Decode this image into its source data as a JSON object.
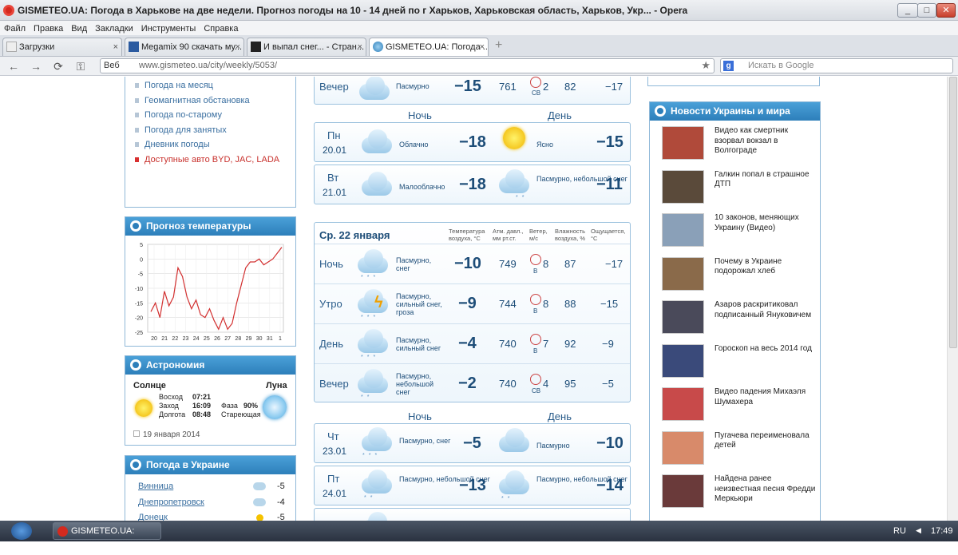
{
  "window": {
    "title": "GISMETEO.UA: Погода в Харькове на две недели. Прогноз погоды на 10 - 14 дней по г Харьков, Харьковская область, Харьков, Укр... - Opera",
    "min": "_",
    "max": "□",
    "close": "✕"
  },
  "menu": [
    "Файл",
    "Правка",
    "Вид",
    "Закладки",
    "Инструменты",
    "Справка"
  ],
  "tabs": [
    {
      "label": "Загрузки",
      "x": 3
    },
    {
      "label": "Megamix 90 скачать му...",
      "x": 156
    },
    {
      "label": "И выпал снег... - Стран...",
      "x": 309
    },
    {
      "label": "GISMETEO.UA: Погода ...",
      "x": 462
    }
  ],
  "tab_close": "×",
  "new_tab": "+",
  "nav": {
    "back": "←",
    "forward": "→",
    "reload": "⟳",
    "key": "⚿",
    "web": "Веб",
    "url": "www.gismeteo.ua/city/weekly/5053/",
    "star": "★"
  },
  "search": {
    "engine": "g",
    "placeholder": "Искать в Google"
  },
  "left_links": [
    {
      "label": "Погода на месяц",
      "red": false
    },
    {
      "label": "Геомагнитная обстановка",
      "red": false
    },
    {
      "label": "Погода по-старому",
      "red": false
    },
    {
      "label": "Погода для занятых",
      "red": false
    },
    {
      "label": "Дневник погоды",
      "red": false
    },
    {
      "label": "Доступные авто BYD, JAC, LADA",
      "red": true
    }
  ],
  "temp_forecast": {
    "title": "Прогноз температуры",
    "y_ticks": [
      "5",
      "0",
      "-5",
      "-10",
      "-15",
      "-20",
      "-25"
    ],
    "x_ticks": [
      "20",
      "21",
      "22",
      "23",
      "24",
      "25",
      "26",
      "27",
      "28",
      "29",
      "30",
      "31",
      "1"
    ],
    "chart_data": {
      "type": "line",
      "x": [
        "20",
        "21",
        "22",
        "23",
        "24",
        "25",
        "26",
        "27",
        "28",
        "29",
        "30",
        "31",
        "1"
      ],
      "ylim": [
        -25,
        5
      ],
      "series": [
        {
          "values": [
            -18,
            -15,
            -20,
            -11,
            -16,
            -13,
            -3,
            -6,
            -13,
            -17,
            -14,
            -19,
            -20,
            -17,
            -21,
            -24,
            -20,
            -24,
            -22,
            -15,
            -9,
            -3,
            -1,
            -1,
            0,
            -2,
            -1,
            0,
            2,
            4
          ]
        }
      ]
    }
  },
  "astronomy": {
    "title": "Астрономия",
    "sun": "Солнце",
    "moon": "Луна",
    "sunrise_label": "Восход",
    "sunrise": "07:21",
    "sunset_label": "Заход",
    "sunset": "16:09",
    "day_label": "Долгота",
    "day": "08:48",
    "phase_label": "Фаза",
    "phase": "90%",
    "phase_name": "Стареющая",
    "date": "19 января 2014"
  },
  "ukraine": {
    "title": "Погода в Украине",
    "cities": [
      {
        "name": "Винница",
        "temp": "-5"
      },
      {
        "name": "Днепропетровск",
        "temp": "-4"
      },
      {
        "name": "Донецк",
        "temp": "-5"
      }
    ]
  },
  "top_row": {
    "label": "Вечер",
    "desc": "Пасмурно",
    "temp": "−15",
    "pressure": "761",
    "wind": "2",
    "dir": "СВ",
    "hum": "82",
    "feels": "−17"
  },
  "col_night": "Ночь",
  "col_day": "День",
  "days_a": [
    {
      "dow": "Пн",
      "date": "20.01",
      "night_desc": "Облачно",
      "night_temp": "−18",
      "day_desc": "Ясно",
      "day_temp": "−15"
    },
    {
      "dow": "Вт",
      "date": "21.01",
      "night_desc": "Малооблачно",
      "night_temp": "−18",
      "day_desc": "Пасмурно, небольшой снег",
      "day_temp": "−11"
    }
  ],
  "detail": {
    "title": "Ср. 22 января",
    "h_temp": "Температура воздуха, °C",
    "h_press": "Атм. давл., мм рт.ст.",
    "h_wind": "Ветер, м/с",
    "h_hum": "Влажность воздуха, %",
    "h_feels": "Ощущается, °C",
    "rows": [
      {
        "label": "Ночь",
        "desc": "Пасмурно, снег",
        "temp": "−10",
        "press": "749",
        "wind": "8",
        "dir": "В",
        "hum": "87",
        "feels": "−17"
      },
      {
        "label": "Утро",
        "desc": "Пасмурно, сильный снег, гроза",
        "temp": "−9",
        "press": "744",
        "wind": "8",
        "dir": "В",
        "hum": "88",
        "feels": "−15"
      },
      {
        "label": "День",
        "desc": "Пасмурно, сильный снег",
        "temp": "−4",
        "press": "740",
        "wind": "7",
        "dir": "В",
        "hum": "92",
        "feels": "−9"
      },
      {
        "label": "Вечер",
        "desc": "Пасмурно, небольшой снег",
        "temp": "−2",
        "press": "740",
        "wind": "4",
        "dir": "СВ",
        "hum": "95",
        "feels": "−5"
      }
    ]
  },
  "days_b": [
    {
      "dow": "Чт",
      "date": "23.01",
      "night_desc": "Пасмурно, снег",
      "night_temp": "−5",
      "day_desc": "Пасмурно",
      "day_temp": "−10"
    },
    {
      "dow": "Пт",
      "date": "24.01",
      "night_desc": "Пасмурно, небольшой снег",
      "night_temp": "−13",
      "day_desc": "Пасмурно, небольшой снег",
      "day_temp": "−14"
    }
  ],
  "news": {
    "title": "Новости Украины и мира",
    "items": [
      {
        "text": "Видео как смертник взорвал вокзал в Волгограде",
        "color": "#b04a3a"
      },
      {
        "text": "Галкин попал в страшное ДТП",
        "color": "#5a4a3a"
      },
      {
        "text": "10 законов, меняющих Украину (Видео)",
        "color": "#8aa0b8"
      },
      {
        "text": "Почему в Украине подорожал хлеб",
        "color": "#8a6a4a"
      },
      {
        "text": "Азаров раскритиковал подписанный Януковичем",
        "color": "#4a4a5a"
      },
      {
        "text": "Гороскоп на весь 2014 год",
        "color": "#3a4a7a"
      },
      {
        "text": "Видео падения Михаэля Шумахера",
        "color": "#c84a4a"
      },
      {
        "text": "Пугачева переименовала детей",
        "color": "#d88a6a"
      },
      {
        "text": "Найдена ранее неизвестная песня Фредди Меркьюри",
        "color": "#6a3a3a"
      }
    ]
  },
  "taskbar": {
    "task": "GISMETEO.UA: Погод...",
    "lang": "RU",
    "time": "17:49"
  }
}
